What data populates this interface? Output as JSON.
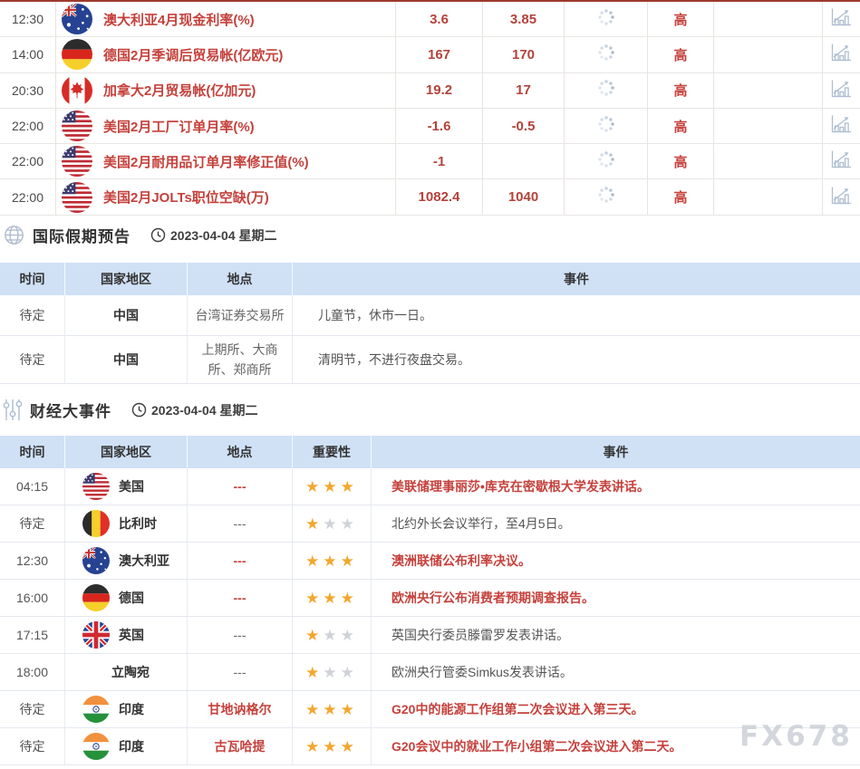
{
  "page": {
    "watermark": "FX678"
  },
  "colors": {
    "accent_red": "#c5413c",
    "value_red": "#b4423a",
    "header_blue_bg": "#d0e1f6",
    "star_gold": "#f3a72e",
    "star_gray": "#cfd3d8",
    "table_top_border": "#9e3a2c",
    "icon_blue_gray": "#aebdd0"
  },
  "data_table": {
    "importance_label": "高",
    "rows": [
      {
        "time": "12:30",
        "flag": "australia",
        "event": "澳大利亚4月现金利率(%)",
        "previous": "3.6",
        "forecast": "3.85",
        "published": "",
        "importance": "高",
        "effect": ""
      },
      {
        "time": "14:00",
        "flag": "germany",
        "event": "德国2月季调后贸易帐(亿欧元)",
        "previous": "167",
        "forecast": "170",
        "published": "",
        "importance": "高",
        "effect": ""
      },
      {
        "time": "20:30",
        "flag": "canada",
        "event": "加拿大2月贸易帐(亿加元)",
        "previous": "19.2",
        "forecast": "17",
        "published": "",
        "importance": "高",
        "effect": ""
      },
      {
        "time": "22:00",
        "flag": "us",
        "event": "美国2月工厂订单月率(%)",
        "previous": "-1.6",
        "forecast": "-0.5",
        "published": "",
        "importance": "高",
        "effect": ""
      },
      {
        "time": "22:00",
        "flag": "us",
        "event": "美国2月耐用品订单月率修正值(%)",
        "previous": "-1",
        "forecast": "",
        "published": "",
        "importance": "高",
        "effect": ""
      },
      {
        "time": "22:00",
        "flag": "us",
        "event": "美国2月JOLTs职位空缺(万)",
        "previous": "1082.4",
        "forecast": "1040",
        "published": "",
        "importance": "高",
        "effect": ""
      }
    ]
  },
  "holiday_section": {
    "title": "国际假期预告",
    "date": "2023-04-04 星期二",
    "headers": [
      "时间",
      "国家地区",
      "地点",
      "事件"
    ],
    "rows": [
      {
        "time": "待定",
        "country": "中国",
        "location": "台湾证券交易所",
        "event": "儿童节，休市一日。"
      },
      {
        "time": "待定",
        "country": "中国",
        "location": "上期所、大商所、郑商所",
        "event": "清明节，不进行夜盘交易。"
      }
    ]
  },
  "events_section": {
    "title": "财经大事件",
    "date": "2023-04-04 星期二",
    "headers": [
      "时间",
      "国家地区",
      "地点",
      "重要性",
      "事件"
    ],
    "rows": [
      {
        "time": "04:15",
        "flag": "us",
        "country": "美国",
        "location": "---",
        "stars": 3,
        "event": "美联储理事丽莎•库克在密歇根大学发表讲话。",
        "important": true
      },
      {
        "time": "待定",
        "flag": "belgium",
        "country": "比利时",
        "location": "---",
        "stars": 1,
        "event": "北约外长会议举行，至4月5日。",
        "important": false
      },
      {
        "time": "12:30",
        "flag": "australia",
        "country": "澳大利亚",
        "location": "---",
        "stars": 3,
        "event": "澳洲联储公布利率决议。",
        "important": true
      },
      {
        "time": "16:00",
        "flag": "germany",
        "country": "德国",
        "location": "---",
        "stars": 3,
        "event": "欧洲央行公布消费者预期调查报告。",
        "important": true
      },
      {
        "time": "17:15",
        "flag": "uk",
        "country": "英国",
        "location": "---",
        "stars": 1,
        "event": "英国央行委员滕雷罗发表讲话。",
        "important": false
      },
      {
        "time": "18:00",
        "flag": "",
        "country": "立陶宛",
        "location": "---",
        "stars": 1,
        "event": "欧洲央行管委Simkus发表讲话。",
        "important": false
      },
      {
        "time": "待定",
        "flag": "india",
        "country": "印度",
        "location": "甘地讷格尔",
        "stars": 3,
        "event": "G20中的能源工作组第二次会议进入第三天。",
        "important": true
      },
      {
        "time": "待定",
        "flag": "india",
        "country": "印度",
        "location": "古瓦哈提",
        "stars": 3,
        "event": "G20会议中的就业工作小组第二次会议进入第二天。",
        "important": true
      }
    ]
  }
}
